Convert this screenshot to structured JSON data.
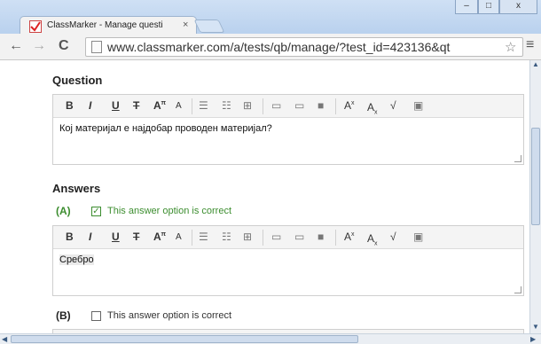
{
  "browser": {
    "tab_title": "ClassMarker - Manage questi",
    "tab_close": "×",
    "url": "www.classmarker.com/a/tests/qb/manage/?test_id=423136&qt",
    "nav": {
      "back": "←",
      "forward": "→",
      "reload": "C"
    },
    "star": "☆",
    "menu": "≡",
    "window": {
      "minimize": "–",
      "maximize": "□",
      "close": "x"
    }
  },
  "editor_toolbar": {
    "bold": "B",
    "italic": "I",
    "underline": "U",
    "strike": "T",
    "font_size": "A",
    "font_size_sup": "π",
    "font_color": "A",
    "ordered_list": "☰",
    "unordered_list": "☷",
    "table": "⊞",
    "hr": "▭",
    "image": "▭",
    "video": "■",
    "superscript": "A",
    "superscript_sup": "x",
    "subscript": "A",
    "subscript_sub": "x",
    "math": "√",
    "paste": "▣"
  },
  "question": {
    "label": "Question",
    "text": "Кој материјал е најдобар проводен материјал?"
  },
  "answers": {
    "label": "Answers",
    "options": [
      {
        "letter": "(A)",
        "correct_label": "This answer option is correct",
        "checked": true,
        "text": "Сребро"
      },
      {
        "letter": "(B)",
        "correct_label": "This answer option is correct",
        "checked": false,
        "text": ""
      }
    ]
  },
  "colors": {
    "correct_green": "#3c8d2f",
    "default_text": "#222222"
  }
}
